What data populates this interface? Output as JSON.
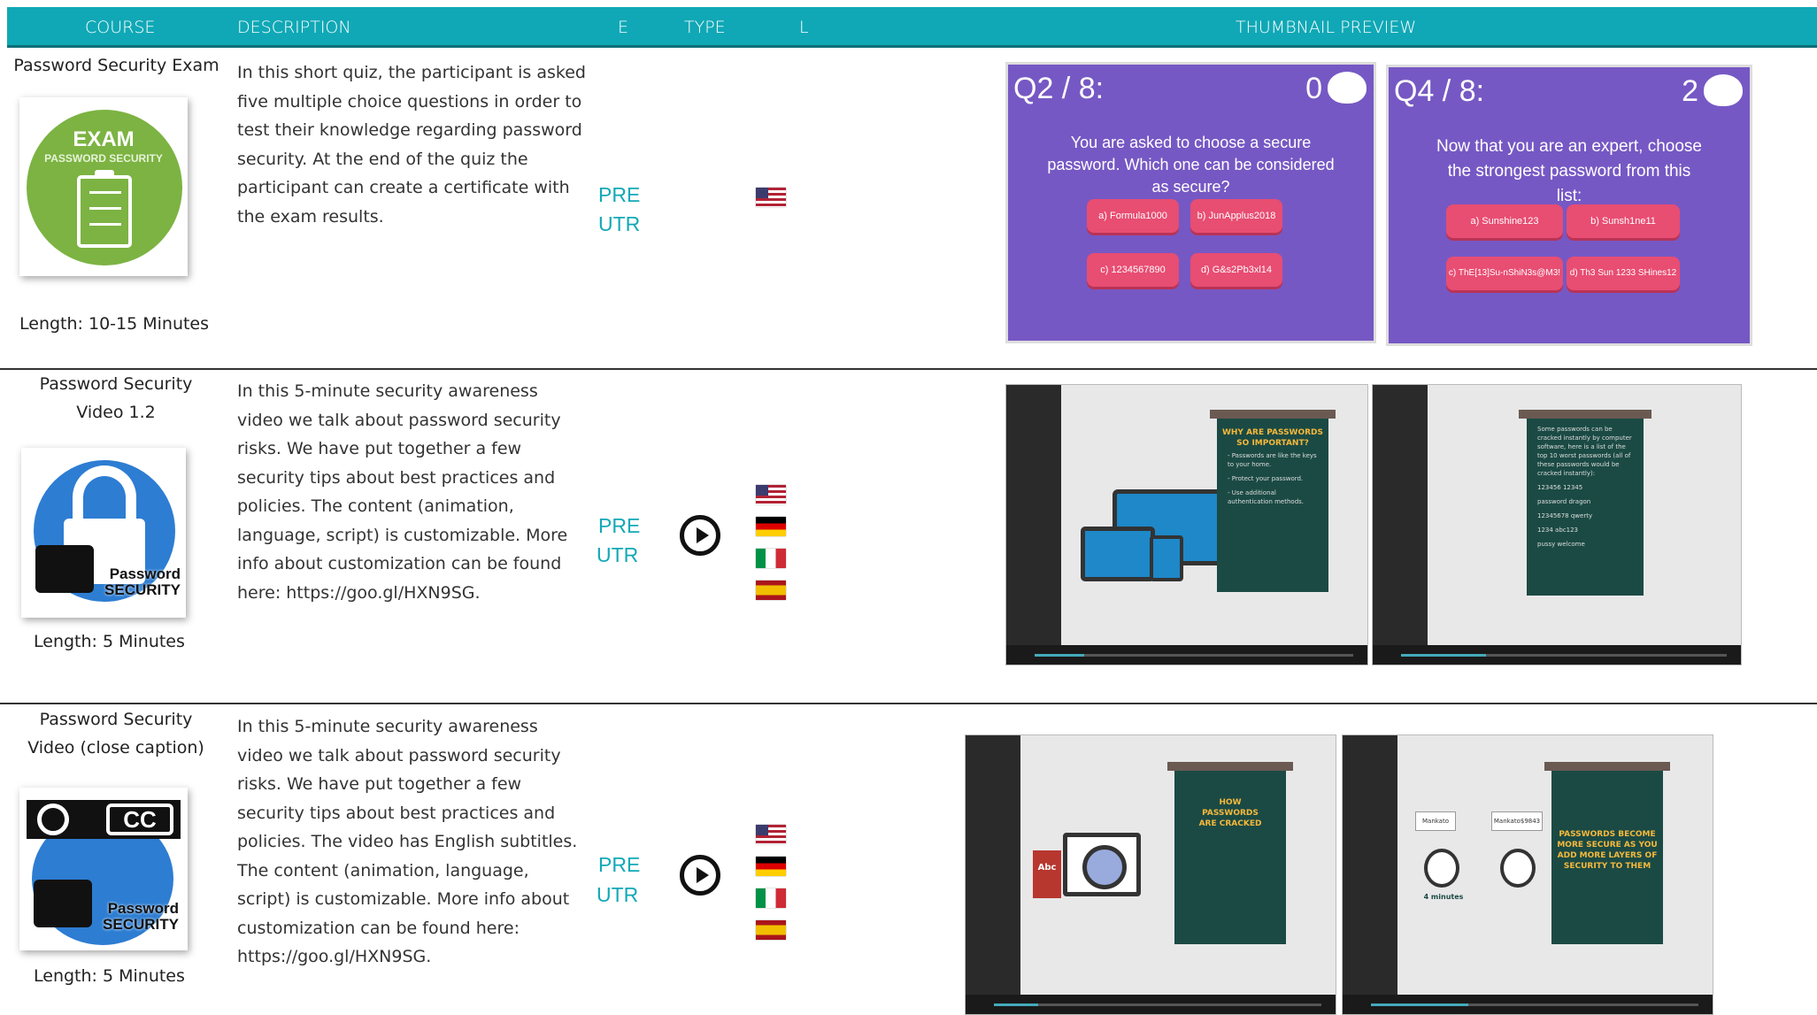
{
  "header": {
    "course": "COURSE",
    "description": "DESCRIPTION",
    "e": "E",
    "type": "TYPE",
    "l": "L",
    "thumbnail": "THUMBNAIL PREVIEW"
  },
  "rows": [
    {
      "name": "Password Security Exam",
      "length": "Length: 10-15 Minutes",
      "description": "In this short quiz, the participant is asked five multiple choice questions in order to test their knowledge regarding password security. At the end of the quiz the participant can create a certificate with the exam results.",
      "pre": "PRE",
      "utr": "UTR",
      "badge": {
        "top": "EXAM",
        "bottom": "PASSWORD SECURITY"
      },
      "quiz": [
        {
          "num": "Q2 / 8:",
          "score": "0",
          "question": "You are asked to choose a secure password. Which one can be considered as secure?",
          "answers": [
            "a) Formula1000",
            "b) JunApplus2018",
            "c) 1234567890",
            "d) G&s2Pb3xl14"
          ]
        },
        {
          "num": "Q4 / 8:",
          "score": "2",
          "question": "Now that you are an expert, choose the strongest password from this list:",
          "answers": [
            "a) Sunshine123",
            "b) Sunsh1ne11",
            "c) ThE[13]Su-nShiN3s@M3!",
            "d) Th3 Sun 1233 SHines12"
          ]
        }
      ]
    },
    {
      "name": "Password Security Video 1.2",
      "length": "Length: 5 Minutes",
      "description": "In this 5-minute security awareness video we talk about password security risks. We have put together a few security tips about best practices and policies. The content (animation, language, script) is customizable. More info about customization can be found here: https://goo.gl/HXN9SG.",
      "pre": "PRE",
      "utr": "UTR",
      "logo_text": "Password SECURITY",
      "video": [
        {
          "title": "WHY ARE PASSWORDS SO IMPORTANT?",
          "lines": [
            "- Passwords are like the keys to your home.",
            "- Protect your password.",
            "- Use additional authentication methods."
          ]
        },
        {
          "title": "",
          "lines": [
            "Some passwords can be cracked instantly by computer software, here is a list of the top 10 worst passwords (all of these passwords would be cracked instantly):",
            "123456   12345",
            "password   dragon",
            "12345678   qwerty",
            "1234   abc123",
            "pussy   welcome"
          ]
        }
      ]
    },
    {
      "name": "Password Security Video (close caption)",
      "length": "Length: 5 Minutes",
      "description": "In this 5-minute security awareness video we talk about password security risks. We have put together a few security tips about best practices and policies. The video has English subtitles. The content (animation, language, script) is customizable. More info about customization can be found here: https://goo.gl/HXN9SG.",
      "pre": "PRE",
      "utr": "UTR",
      "logo_text": "Password SECURITY",
      "cc": "CC",
      "video": [
        {
          "title": "HOW PASSWORDS ARE CRACKED",
          "lines": []
        },
        {
          "title": "PASSWORDS BECOME MORE SECURE AS YOU ADD MORE LAYERS OF SECURITY TO THEM",
          "lines": []
        }
      ],
      "tags": [
        "Abc",
        "Mankato",
        "Mankato$9843",
        "4 minutes"
      ]
    }
  ],
  "colors": {
    "header": "#10a8b6",
    "accent": "#12a9b7",
    "quiz_bg": "#7658c4",
    "answer": "#e84d72"
  }
}
